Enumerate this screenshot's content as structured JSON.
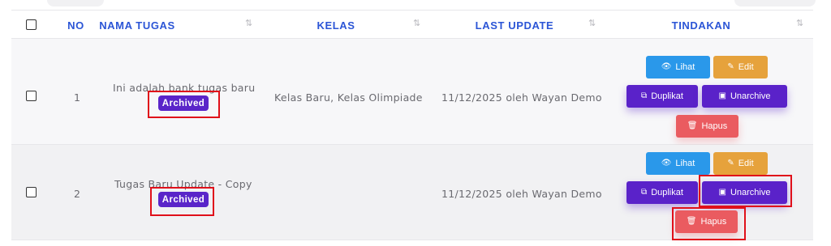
{
  "table": {
    "headers": {
      "no": "NO",
      "nama_tugas": "NAMA TUGAS",
      "kelas": "KELAS",
      "last_update": "LAST UPDATE",
      "tindakan": "TINDAKAN"
    },
    "sort_icon": "⇅",
    "rows": [
      {
        "no": "1",
        "nama_tugas": "Ini adalah bank tugas baru",
        "status": "Archived",
        "kelas": "Kelas Baru, Kelas Olimpiade",
        "last_update": "11/12/2025 oleh Wayan Demo"
      },
      {
        "no": "2",
        "nama_tugas": "Tugas Baru Update - Copy",
        "status": "Archived",
        "kelas": "",
        "last_update": "11/12/2025 oleh Wayan Demo"
      }
    ]
  },
  "actions": {
    "lihat": "Lihat",
    "edit": "Edit",
    "duplikat": "Duplikat",
    "unarchive": "Unarchive",
    "hapus": "Hapus"
  },
  "icons": {
    "lihat": "eye-icon",
    "edit": "edit-icon",
    "duplikat": "copy-icon",
    "unarchive": "archive-box-icon",
    "hapus": "trash-icon"
  },
  "colors": {
    "header_text": "#2b55d6",
    "badge": "#5a25c9",
    "lihat": "#2a98ea",
    "edit": "#e6a23c",
    "duplikat": "#5a22c9",
    "unarchive": "#5a22c9",
    "hapus": "#ea5b60",
    "highlight": "#e0101a"
  }
}
